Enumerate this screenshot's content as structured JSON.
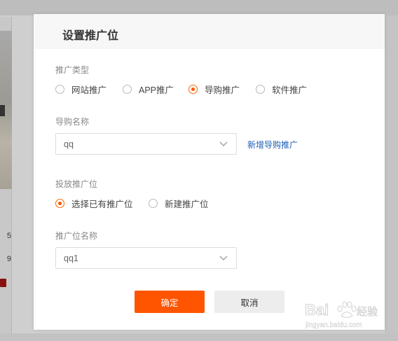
{
  "background": {
    "numbers": [
      "5",
      "9"
    ]
  },
  "dialog": {
    "title": "设置推广位",
    "promo_type": {
      "label": "推广类型",
      "options": [
        {
          "label": "网站推广",
          "checked": false
        },
        {
          "label": "APP推广",
          "checked": false
        },
        {
          "label": "导购推广",
          "checked": true
        },
        {
          "label": "软件推广",
          "checked": false
        }
      ]
    },
    "guide_name": {
      "label": "导购名称",
      "value": "qq",
      "add_link": "新增导购推广"
    },
    "placement": {
      "label": "投放推广位",
      "options": [
        {
          "label": "选择已有推广位",
          "checked": true
        },
        {
          "label": "新建推广位",
          "checked": false
        }
      ]
    },
    "placement_name": {
      "label": "推广位名称",
      "value": "qq1"
    },
    "buttons": {
      "confirm": "确定",
      "cancel": "取消"
    }
  },
  "watermark": {
    "brand": "Bai",
    "brand_tail": "经验",
    "url": "jingyan.baidu.com"
  },
  "colors": {
    "accent": "#ff5500",
    "link": "#1e5fb4"
  }
}
